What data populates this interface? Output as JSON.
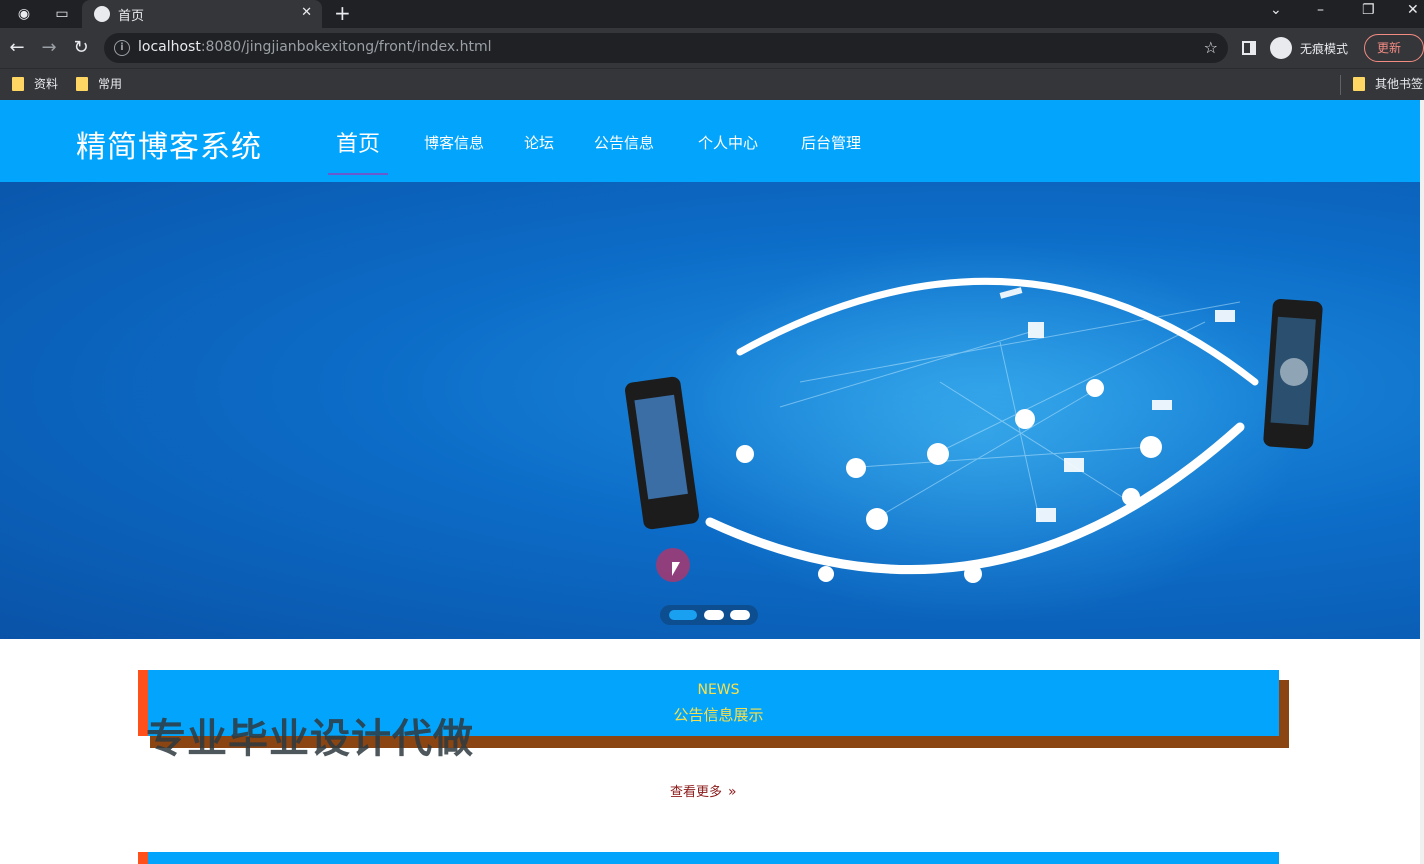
{
  "browser": {
    "tab_title": "首页",
    "url_host": "localhost",
    "url_rest": ":8080/jingjianbokexitong/front/index.html",
    "incognito_label": "无痕模式",
    "update_label": "更新",
    "bookmarks": [
      "资料",
      "常用"
    ],
    "other_bookmarks": "其他书签"
  },
  "site": {
    "logo": "精简博客系统",
    "nav": [
      "首页",
      "博客信息",
      "论坛",
      "公告信息",
      "个人中心",
      "后台管理"
    ],
    "active_nav": "首页"
  },
  "banner": {
    "slide_count": 3,
    "active_slide": 1
  },
  "news": {
    "title_en": "NEWS",
    "title_cn": "公告信息展示",
    "more_label": "查看更多",
    "watermark": "专业毕业设计代做"
  },
  "colors": {
    "header": "#03a5fc",
    "accent_left": "#ff4f1a",
    "news_text": "#f9e04b",
    "shadow": "#8b4513"
  }
}
